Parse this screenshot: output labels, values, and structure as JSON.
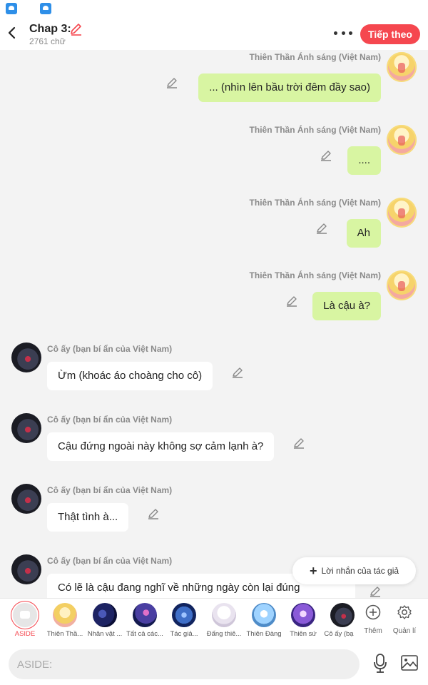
{
  "header": {
    "title": "Chap 3:",
    "word_count": "2761 chữ",
    "next_label": "Tiếp theo",
    "accent_color": "#f5474f"
  },
  "messages": [
    {
      "side": "right",
      "speaker": "Thiên Thần Ánh sáng (Việt Nam)",
      "text": "... (nhìn lên bầu trời đêm đầy sao)"
    },
    {
      "side": "right",
      "speaker": "Thiên Thần Ánh sáng (Việt Nam)",
      "text": "...."
    },
    {
      "side": "right",
      "speaker": "Thiên Thần Ánh sáng (Việt Nam)",
      "text": "Ah"
    },
    {
      "side": "right",
      "speaker": "Thiên Thần Ánh sáng (Việt Nam)",
      "text": "Là cậu à?"
    },
    {
      "side": "left",
      "speaker": "Cô ấy (bạn bí ẩn của Việt Nam)",
      "text": "Ừm (khoác áo choàng cho cô)"
    },
    {
      "side": "left",
      "speaker": "Cô ấy (bạn bí ẩn của Việt Nam)",
      "text": "Cậu đứng ngoài này không sợ cảm lạnh à?"
    },
    {
      "side": "left",
      "speaker": "Cô ấy (bạn bí ẩn của Việt Nam)",
      "text": "Thật tình à..."
    },
    {
      "side": "left",
      "speaker": "Cô ấy (bạn bí ẩn của Việt Nam)",
      "text": "Có lẽ là cậu đang nghĩ về những ngày còn lại đúng"
    }
  ],
  "author_note": {
    "label": "Lời nhắn của tác giả"
  },
  "characters": [
    {
      "label": "ASIDE"
    },
    {
      "label": "Thiên Thầ..."
    },
    {
      "label": "Nhân vật ..."
    },
    {
      "label": "Tất cả các..."
    },
    {
      "label": "Tác giả..."
    },
    {
      "label": "Đấng thiê..."
    },
    {
      "label": "Thiên Đàng"
    },
    {
      "label": "Thiên sứ"
    },
    {
      "label": "Cô ấy (bạ"
    }
  ],
  "tools": {
    "add_label": "Thêm",
    "manage_label": "Quản lí"
  },
  "input": {
    "placeholder": "ASIDE:"
  }
}
